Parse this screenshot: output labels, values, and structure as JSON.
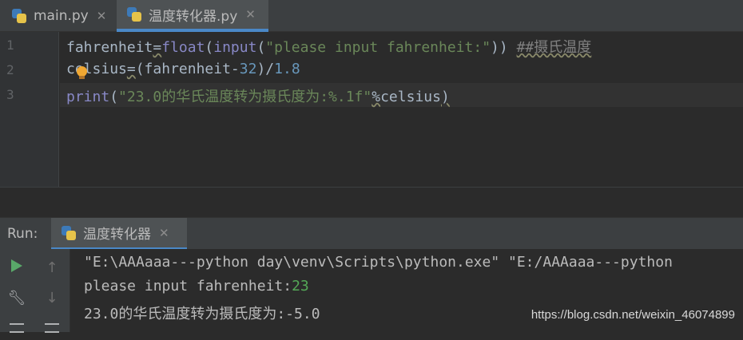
{
  "tabs": [
    {
      "name": "main.py",
      "close": "✕"
    },
    {
      "name": "温度转化器.py",
      "close": "✕",
      "active": true
    }
  ],
  "editor": {
    "line_numbers": [
      "1",
      "2",
      "3"
    ],
    "line1": {
      "var": "fahrenheit",
      "eq": "=",
      "fn_float": "float",
      "paren_open": "(",
      "fn_input": "input",
      "paren_open2": "(",
      "prompt": "\"please input fahrenheit:\"",
      "paren_close": "))",
      "comment": "##摄氏温度"
    },
    "line2": {
      "var_c": "c",
      "var_rest": "elsius",
      "eq": "=",
      "expr_open": "(fahrenheit-",
      "num32": "32",
      "expr_mid": ")/",
      "num18": "1.8"
    },
    "line3": {
      "fn_print": "print",
      "paren_open": "(",
      "fmt": "\"23.0的华氏温度转为摄氏度为:%.1f\"",
      "pct": "%",
      "var": "celsius",
      "paren_close": ")"
    }
  },
  "run_panel": {
    "label": "Run:",
    "tab_name": "温度转化器",
    "tab_close": "✕",
    "output": {
      "line1": "\"E:\\AAAaaa---python day\\venv\\Scripts\\python.exe\" \"E:/AAAaaa---python",
      "line2_prompt": "please input fahrenheit:",
      "line2_input": "23",
      "line3": "23.0的华氏温度转为摄氏度为:-5.0"
    }
  },
  "watermark": "https://blog.csdn.net/weixin_46074899",
  "colors": {
    "background": "#2b2b2b",
    "keyword": "#8888c6",
    "string": "#6a8759",
    "number": "#6897bb",
    "user_input": "#54a857",
    "tab_underline": "#4a88c7"
  },
  "icons": [
    "python-file-icon",
    "close-icon",
    "bulb-icon",
    "run-icon",
    "wrench-icon",
    "up-arrow-icon",
    "down-arrow-icon",
    "list-icon"
  ]
}
